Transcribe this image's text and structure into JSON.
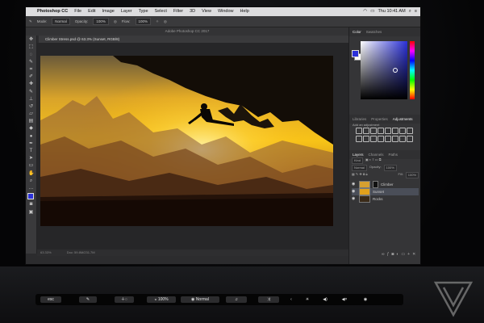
{
  "menubar": {
    "apple": "",
    "app_name": "Photoshop CC",
    "items": [
      "File",
      "Edit",
      "Image",
      "Layer",
      "Type",
      "Select",
      "Filter",
      "3D",
      "View",
      "Window",
      "Help"
    ],
    "clock": "Thu 10:41 AM"
  },
  "options_bar": {
    "mode_label": "Mode:",
    "mode_value": "Normal",
    "opacity_label": "Opacity:",
    "opacity_value": "100%",
    "flow_label": "Flow:",
    "flow_value": "100%"
  },
  "window": {
    "title": "Adobe Photoshop CC 2017",
    "doc_tab": "Climber Stress.psd @ 63.3% (Sunset, RGB/8)",
    "status_left": "63.33%",
    "status_doc": "Doc: 59.8M/231.7M"
  },
  "panels": {
    "color_tabs": [
      "Color",
      "Swatches"
    ],
    "adjust_tabs": [
      "Libraries",
      "Properties",
      "Adjustments"
    ],
    "add_adjustment": "Add an adjustment",
    "layers_tabs": [
      "Layers",
      "Channels",
      "Paths"
    ],
    "kind_label": "Kind",
    "blend_mode": "Normal",
    "opacity_label": "Opacity:",
    "opacity_value": "100%",
    "fill_label": "Fill:",
    "fill_value": "100%",
    "layers": [
      {
        "name": "Climber",
        "selected": false
      },
      {
        "name": "Sunset",
        "selected": true
      },
      {
        "name": "Rocks",
        "selected": false
      }
    ]
  },
  "touchbar": {
    "esc": "esc",
    "opacity": "100%",
    "blend": "Normal"
  },
  "colors": {
    "foreground": "#2b31d9",
    "accent_selection": "#4a4e58"
  }
}
